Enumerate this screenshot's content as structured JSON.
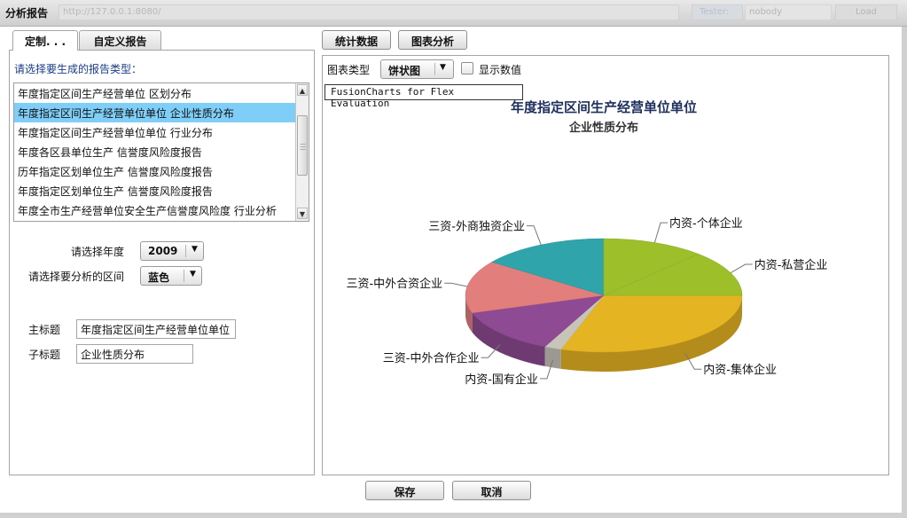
{
  "header": {
    "app_title": "分析报告",
    "url": "http://127.0.0.1:8080/",
    "tester_label": "Tester:",
    "tester_value": "nobody",
    "load_label": "Load"
  },
  "left_tabs": [
    {
      "label": "定制. . ."
    },
    {
      "label": "自定义报告"
    }
  ],
  "right_tabs": [
    {
      "label": "统计数据"
    },
    {
      "label": "图表分析"
    }
  ],
  "report_type_prompt": "请选择要生成的报告类型：",
  "report_list": {
    "items": [
      "年度指定区间生产经营单位 区划分布",
      "年度指定区间生产经营单位单位 企业性质分布",
      "年度指定区间生产经营单位单位 行业分布",
      "年度各区县单位生产 信誉度风险度报告",
      "历年指定区划单位生产 信誉度风险度报告",
      "年度指定区划单位生产 信誉度风险度报告",
      "年度全市生产经营单位安全生产信誉度风险度 行业分析"
    ],
    "selected_index": 1
  },
  "form": {
    "year_label": "请选择年度",
    "year_value": "2009",
    "range_label": "请选择要分析的区间",
    "range_value": "蓝色",
    "main_title_label": "主标题",
    "main_title_value": "年度指定区间生产经营单位单位",
    "sub_title_label": "子标题",
    "sub_title_value": "企业性质分布"
  },
  "chart_controls": {
    "type_label": "图表类型",
    "type_value": "饼状图",
    "show_values_label": "显示数值",
    "show_values_checked": false,
    "watermark": "FusionCharts for Flex Evaluation"
  },
  "chart_data": {
    "type": "pie",
    "title": "年度指定区间生产经营单位单位",
    "subtitle": "企业性质分布",
    "categories": [
      "内资-集体企业",
      "内资-国有企业",
      "三资-中外合作企业",
      "三资-中外合资企业",
      "三资-外商独资企业",
      "内资-个体企业",
      "内资-私营企业"
    ],
    "values": [
      30,
      2,
      13,
      15,
      15,
      12,
      13
    ],
    "colors": [
      "#e5b422",
      "#c7c4ba",
      "#8e4a92",
      "#e27e7c",
      "#2fa4ab",
      "#9cbf2a",
      "#9cbf2a"
    ],
    "legend": "none",
    "labels_outside": true
  },
  "footer": {
    "save_label": "保存",
    "cancel_label": "取消"
  },
  "icons": {
    "dropdown_arrow": "chevron-down-icon",
    "scroll_up": "arrow-up-icon",
    "scroll_down": "arrow-down-icon"
  }
}
